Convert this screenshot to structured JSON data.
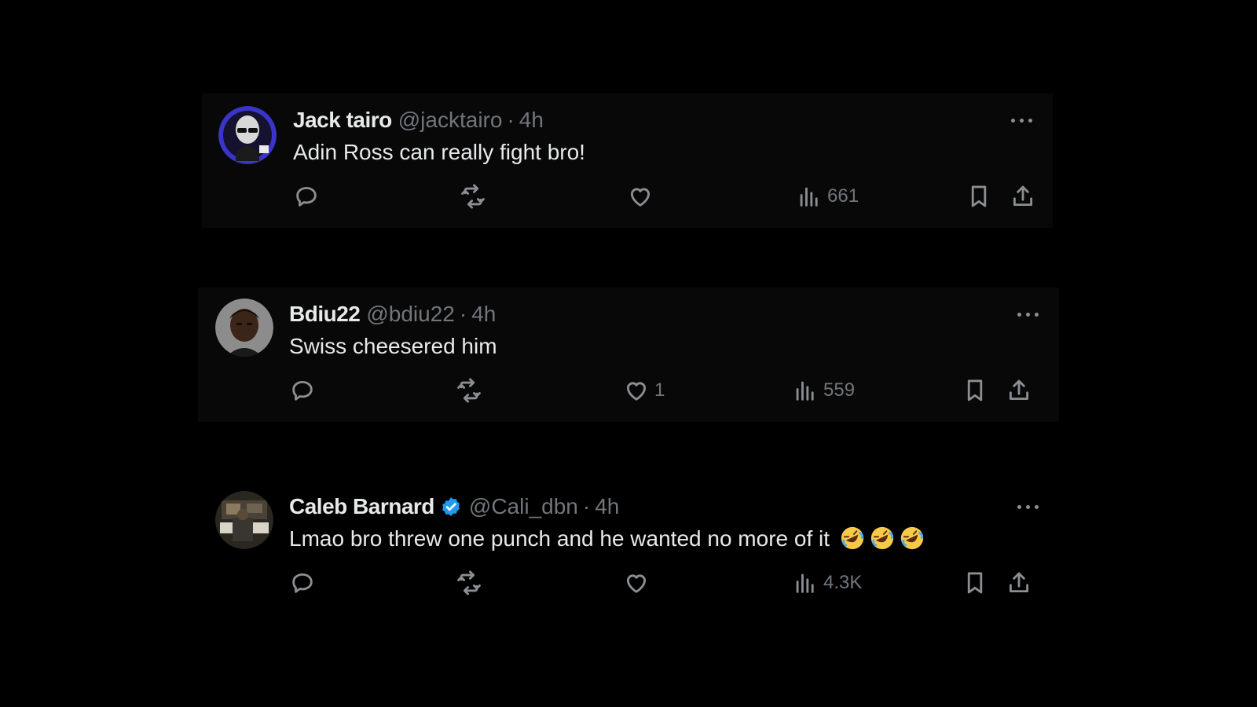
{
  "tweets": [
    {
      "name": "Jack tairo",
      "handle": "@jacktairo",
      "separator": "·",
      "time": "4h",
      "verified": false,
      "text": "Adin Ross can really fight bro!",
      "avatar_icon": "bald-man-sunglasses-avatar",
      "likes": "",
      "views": "661"
    },
    {
      "name": "Bdiu22",
      "handle": "@bdiu22",
      "separator": "·",
      "time": "4h",
      "verified": false,
      "text": "Swiss cheesered him",
      "avatar_icon": "man-portrait-avatar",
      "likes": "1",
      "views": "559"
    },
    {
      "name": "Caleb Barnard",
      "handle": "@Cali_dbn",
      "separator": "·",
      "time": "4h",
      "verified": true,
      "text": "Lmao bro threw one punch and he wanted no more of it",
      "emoji": "rolling-on-floor-laughing-emoji",
      "emoji_count": 3,
      "avatar_icon": "studio-photo-avatar",
      "likes": "",
      "views": "4.3K"
    }
  ],
  "colors": {
    "background": "#000000",
    "card": "#080808",
    "text_primary": "#e7e9ea",
    "text_secondary": "#71767b",
    "verified_blue": "#1d9bf0",
    "emoji_yellow": "#f7c948"
  }
}
